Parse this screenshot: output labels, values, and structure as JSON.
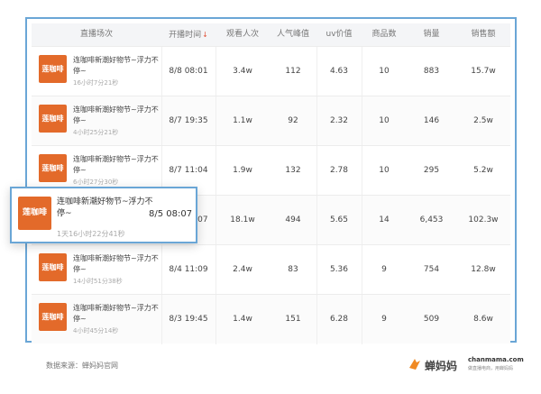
{
  "table": {
    "headers": {
      "live": "直播场次",
      "start": "开播时间",
      "viewers": "观看人次",
      "peak": "人气峰值",
      "uv": "uv价值",
      "products": "商品数",
      "sales": "销量",
      "revenue": "销售额"
    },
    "sort_indicator": "↓",
    "rows": [
      {
        "cover": "莲咖啡",
        "title": "连咖啡新潮好物节~浮力不停~",
        "duration": "16小时7分21秒",
        "start": "8/8 08:01",
        "viewers": "3.4w",
        "peak": "112",
        "uv": "4.63",
        "products": "10",
        "sales": "883",
        "revenue": "15.7w"
      },
      {
        "cover": "莲咖啡",
        "title": "连咖啡新潮好物节~浮力不停~",
        "duration": "4小时25分21秒",
        "start": "8/7 19:35",
        "viewers": "1.1w",
        "peak": "92",
        "uv": "2.32",
        "products": "10",
        "sales": "146",
        "revenue": "2.5w"
      },
      {
        "cover": "莲咖啡",
        "title": "连咖啡新潮好物节~浮力不停~",
        "duration": "6小时27分30秒",
        "start": "8/7 11:04",
        "viewers": "1.9w",
        "peak": "132",
        "uv": "2.78",
        "products": "10",
        "sales": "295",
        "revenue": "5.2w"
      },
      {
        "cover": "莲咖啡",
        "title": "连咖啡新潮好物节~浮力不停~",
        "duration": "1天16小时22分41秒",
        "start": "8/5 08:07",
        "viewers": "18.1w",
        "peak": "494",
        "uv": "5.65",
        "products": "14",
        "sales": "6,453",
        "revenue": "102.3w"
      },
      {
        "cover": "莲咖啡",
        "title": "连咖啡新潮好物节~浮力不停~",
        "duration": "14小时51分38秒",
        "start": "8/4 11:09",
        "viewers": "2.4w",
        "peak": "83",
        "uv": "5.36",
        "products": "9",
        "sales": "754",
        "revenue": "12.8w"
      },
      {
        "cover": "莲咖啡",
        "title": "连咖啡新潮好物节~浮力不停~",
        "duration": "4小时45分14秒",
        "start": "8/3 19:45",
        "viewers": "1.4w",
        "peak": "151",
        "uv": "6.28",
        "products": "9",
        "sales": "509",
        "revenue": "8.6w"
      }
    ]
  },
  "footer": {
    "source": "数据来源：蝉妈妈官网",
    "brand_name": "蝉妈妈",
    "brand_domain": "chanmama.com",
    "brand_slogan": "做直播电商，用蝉妈妈"
  },
  "colors": {
    "accent_border": "#6aa6d6",
    "cover_bg": "#e36a2a",
    "brand_orange": "#f08a24",
    "sort_red": "#e0533a"
  }
}
